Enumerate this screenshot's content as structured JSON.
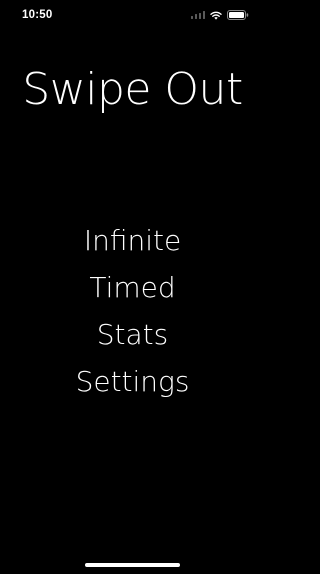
{
  "status_bar": {
    "time": "10:50",
    "icons": [
      "cellular-signal-icon",
      "wifi-icon",
      "battery-icon"
    ]
  },
  "app": {
    "title": "Swipe Out"
  },
  "menu": {
    "items": [
      {
        "label": "Infinite"
      },
      {
        "label": "Timed"
      },
      {
        "label": "Stats"
      },
      {
        "label": "Settings"
      }
    ]
  },
  "colors": {
    "background": "#000000",
    "text": "#ffffff"
  }
}
